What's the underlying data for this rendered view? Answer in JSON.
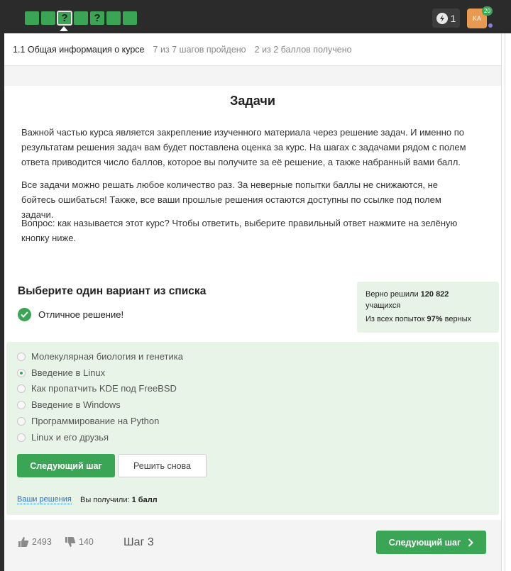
{
  "topbar": {
    "steps": [
      "",
      "",
      "?",
      "",
      "?",
      "",
      ""
    ],
    "energy_count": "1",
    "avatar_initials": "KA",
    "avatar_badge": "20"
  },
  "lesson": {
    "title": "1.1 Общая информация о курсе",
    "steps_progress": "7 из 7 шагов пройдено",
    "score": "2 из 2 баллов  получено"
  },
  "main": {
    "heading": "Задачи",
    "paragraphs": [
      "Важной частью курса является закрепление изученного материала через решение задач. И именно по результатам решения задач вам будет поставлена оценка за курс. На шагах с задачами рядом с полем ответа приводится число баллов, которое вы получите за её решение, а также набранный вами балл.",
      "Все задачи можно решать любое количество раз. За неверные попытки баллы не снижаются, не бойтесь ошибаться! Также, все ваши прошлые решения остаются доступны по ссылке под полем задачи.",
      "Вопрос: как называется этот курс? Чтобы ответить, выберите правильный ответ нажмите на зелёную кнопку ниже."
    ]
  },
  "quiz": {
    "title": "Выберите один вариант из списка",
    "success_text": "Отличное решение!",
    "stats": {
      "solved_prefix": "Верно решили",
      "solved_count": "120 822",
      "solved_suffix": "учащихся",
      "attempts_prefix": "Из всех попыток",
      "attempts_percent": "97%",
      "attempts_suffix": "верных"
    },
    "options": [
      {
        "label": "Молекулярная биология и генетика",
        "selected": false
      },
      {
        "label": "Введение в Linux",
        "selected": true
      },
      {
        "label": "Как пропатчить KDE под FreeBSD",
        "selected": false
      },
      {
        "label": "Введение в Windows",
        "selected": false
      },
      {
        "label": "Программирование на Python",
        "selected": false
      },
      {
        "label": "Linux и его друзья",
        "selected": false
      }
    ],
    "next_button": "Следующий шаг",
    "retry_button": "Решить снова",
    "solutions_link": "Ваши решения",
    "got_prefix": "Вы получили:",
    "got_value": "1 балл"
  },
  "footer": {
    "likes": "2493",
    "dislikes": "140",
    "step_label": "Шаг 3",
    "next_button": "Следующий шаг"
  }
}
